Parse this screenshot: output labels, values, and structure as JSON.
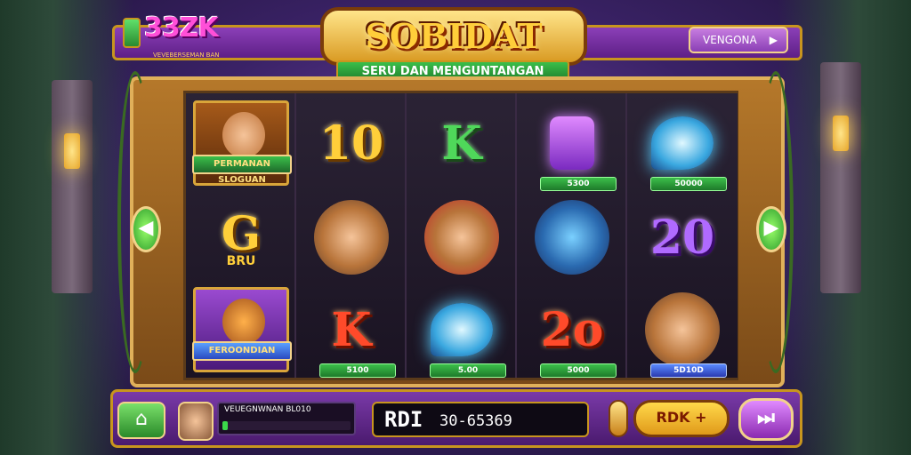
{
  "brand": {
    "logo": "33ZK",
    "tagline": "VEVEBERSEMAN BAN"
  },
  "header": {
    "title": "SOBIDAT",
    "subtitle": "SERU DAN MENGUNTANGAN",
    "vendor_label": "VENGONA",
    "vendor_arrow": "▶"
  },
  "reels": {
    "col1": {
      "top_banner": "PERMANAN SLOGUAN",
      "mid_symbol": "G",
      "mid_caption": "BRU",
      "bottom_banner": "FEROONDIAN"
    },
    "col2": {
      "top": "10",
      "bottom": "K",
      "bet": "5100"
    },
    "col3": {
      "top": "K",
      "bet": "5.00"
    },
    "col4": {
      "bet_top": "5300",
      "bottom": "2o",
      "bet_bottom": "5000"
    },
    "col5": {
      "bet_top": "50000",
      "mid": "20",
      "bet_bottom": "5D10D"
    }
  },
  "nav": {
    "left_arrow": "◀",
    "right_arrow": "▶"
  },
  "bottom": {
    "home_icon": "⌂",
    "player_name": "VEUEGNWNAN BL010",
    "progress": 0.04,
    "balance_label": "RDI",
    "balance_value": "30-65369",
    "spin_label": "RDK +",
    "autoplay_label": "⏭"
  },
  "colors": {
    "accent": "#c8951e",
    "frame": "#8b3fb8",
    "green": "#3bbf4a"
  }
}
